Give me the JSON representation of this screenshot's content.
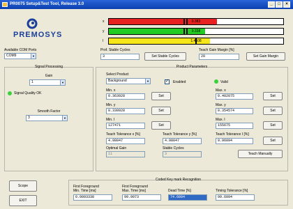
{
  "title": "PR0075 Setup&Test Tool, Release 3.0",
  "logo": {
    "text": "PREMOSYS"
  },
  "bars": [
    {
      "axis": "x",
      "value": "0.383",
      "fill": 0.62,
      "color": "#e82020"
    },
    {
      "axis": "y",
      "value": "0.338",
      "fill": 0.55,
      "color": "#22cc22"
    },
    {
      "axis": "I",
      "value": "1.4608",
      "fill": 0.58,
      "color": "#f4e618"
    }
  ],
  "com": {
    "label": "Available COM Ports",
    "value": "COM9"
  },
  "prof": {
    "label": "Prof. Stable Cycles",
    "value": "3",
    "button": "Set Stable Cycles"
  },
  "teach_gain": {
    "label": "Teach Gain Margin [%]",
    "value": "20",
    "button": "Set Gain Margin"
  },
  "signal": {
    "title": "Signal Processing",
    "gain_label": "Gain",
    "gain_value": "1",
    "quality": "Signal Quality OK",
    "smooth_label": "Smooth Factor",
    "smooth_value": "3"
  },
  "product": {
    "title": "Product Parameters",
    "select_label": "Select Product",
    "select_value": "Background",
    "enabled": "Enabled",
    "valid": "Valid",
    "min_x_label": "Min. x",
    "min_x": "0.363928",
    "min_y_label": "Min. y",
    "min_y": "0.330928",
    "min_i_label": "Min. I",
    "min_i": "127471",
    "max_x_label": "Max. x",
    "max_x": "0.402075",
    "max_y_label": "Max. y",
    "max_y": "0.354574",
    "max_i_label": "Max. I",
    "max_i": "155675",
    "tol_x_label": "Teach Tolerance x [%]",
    "tol_x": "4.98047",
    "tol_y_label": "Teach Tolerance y [%]",
    "tol_y": "4.98047",
    "tol_i_label": "Teach Tolerance I [%]",
    "tol_i": "9.96094",
    "opt_gain_label": "Optimal Gain",
    "opt_gain": "11",
    "stable_label": "Stable Cycles",
    "stable": "3",
    "set": "Set",
    "teach": "Teach Manually"
  },
  "buttons": {
    "scope": "Scope",
    "exit": "EXIT"
  },
  "keymark": {
    "title": "Coded Key mark Recognition",
    "first_min_label1": "First Foreground",
    "first_min_label2": "Min. Time [ms]",
    "first_min": "0.0093338",
    "first_max_label1": "First Foreground",
    "first_max_label2": "Max. Time [ms]",
    "first_max": "99.9973",
    "dead_label": "Dead Time [%]",
    "dead": "74.6094",
    "timing_label": "Timing Tolerance [%]",
    "timing": "99.6094"
  }
}
